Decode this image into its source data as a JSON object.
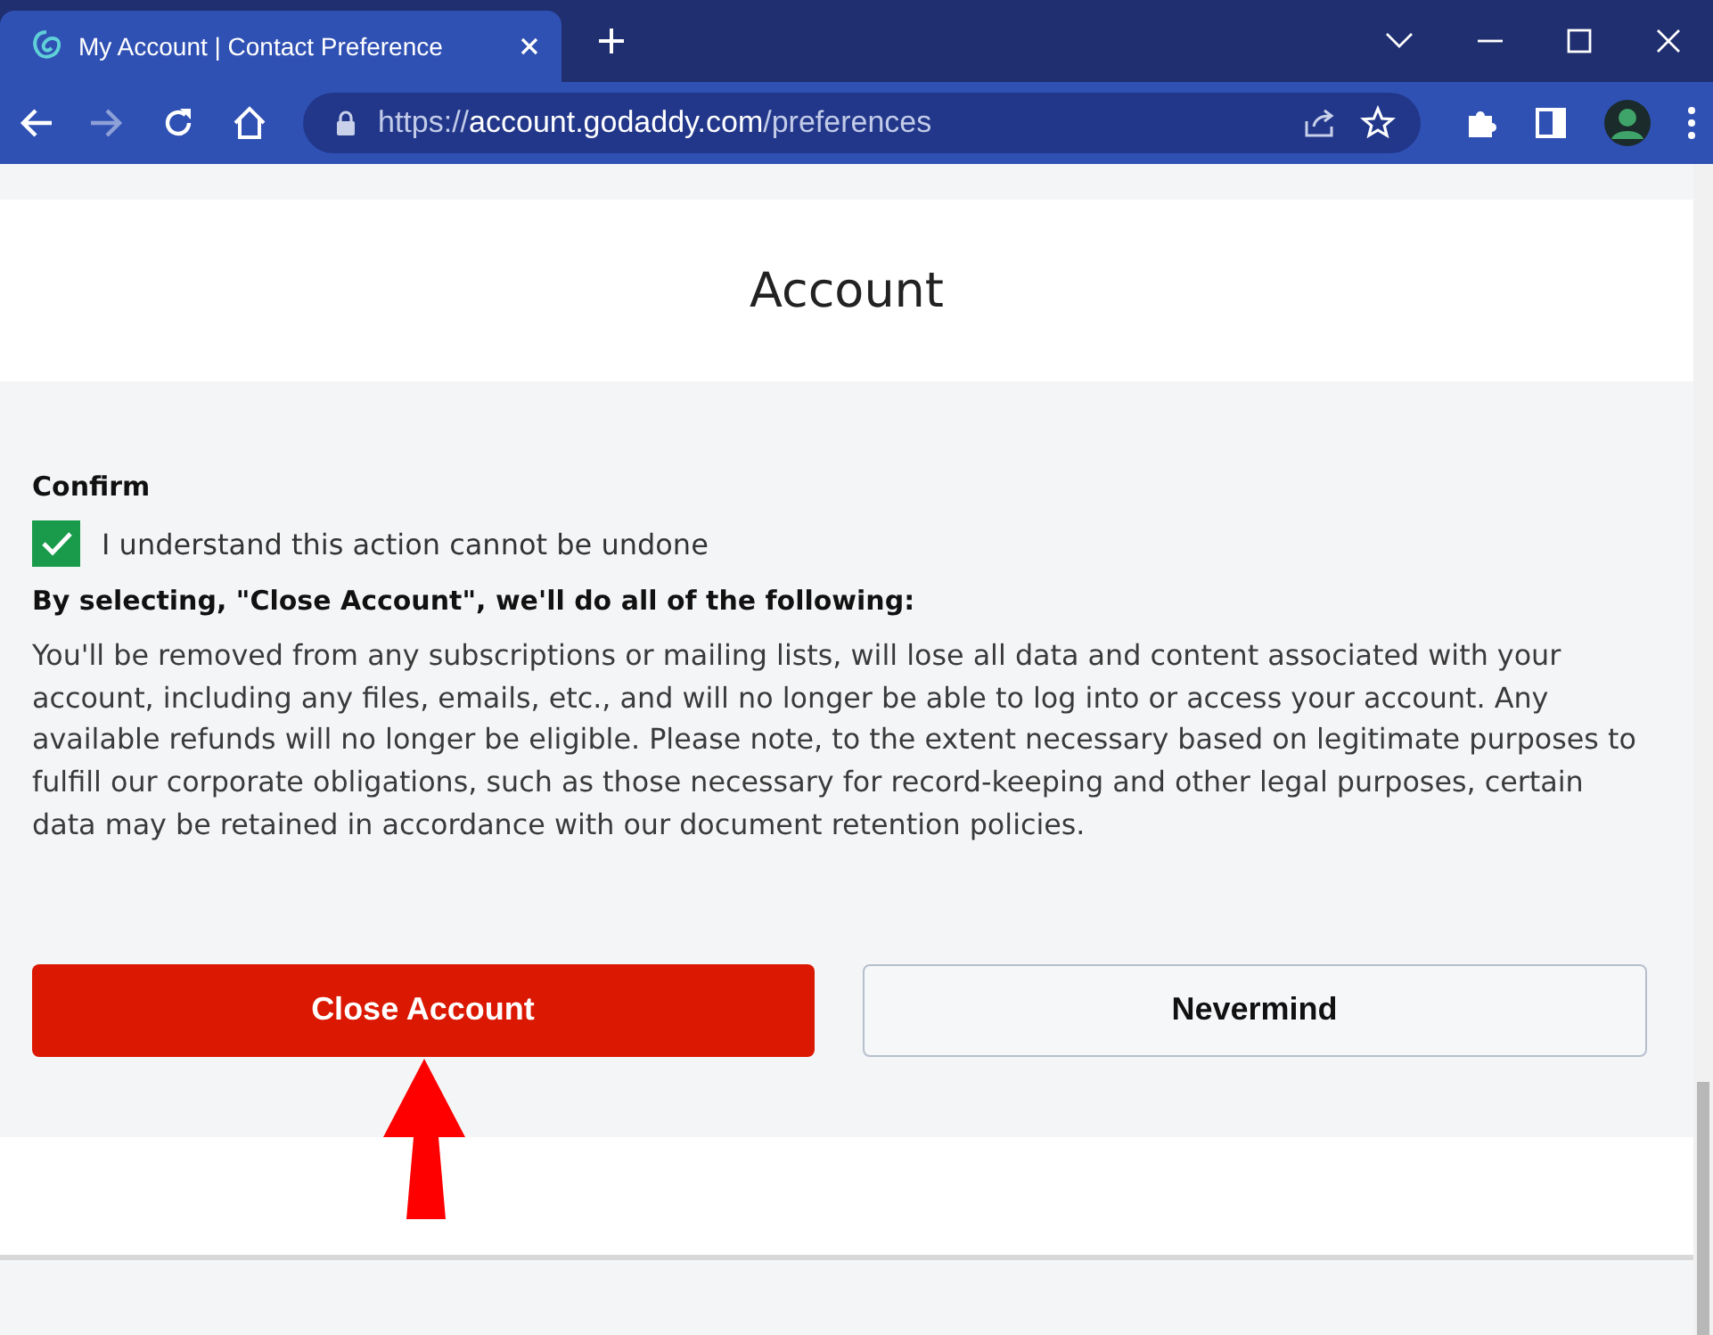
{
  "browser": {
    "tab": {
      "title": "My Account | Contact Preference",
      "selected": true
    },
    "url": {
      "scheme": "https://",
      "host": "account.godaddy.com",
      "path": "/preferences"
    }
  },
  "page": {
    "heading": "Account",
    "confirm_label": "Confirm",
    "checkbox": {
      "label": "I understand this action cannot be undone",
      "checked": true
    },
    "notice_title": "By selecting, \"Close Account\", we'll do all of the following:",
    "notice_body": "You'll be removed from any subscriptions or mailing lists, will lose all data and content associated with your account, including any files, emails, etc., and will no longer be able to log into or access your account. Any available refunds will no longer be eligible. Please note, to the extent necessary based on legitimate purposes to fulfill our corporate obligations, such as those necessary for record-keeping and other legal purposes, certain data may be retained in accordance with our document retention policies.",
    "buttons": [
      {
        "label": "Close Account",
        "kind": "primary"
      },
      {
        "label": "Nevermind",
        "kind": "secondary"
      }
    ]
  }
}
